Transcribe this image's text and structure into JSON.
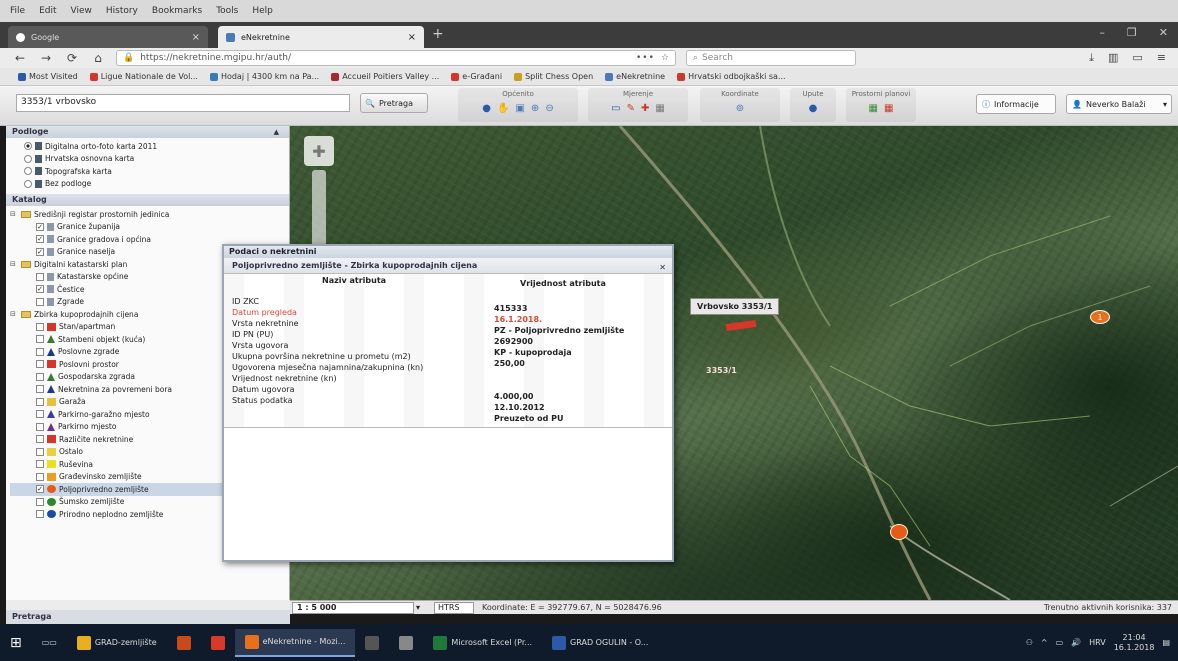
{
  "menu": [
    "File",
    "Edit",
    "View",
    "History",
    "Bookmarks",
    "Tools",
    "Help"
  ],
  "tabs": [
    {
      "label": "Google",
      "close": "×"
    },
    {
      "label": "eNekretnine",
      "close": "×"
    }
  ],
  "newtab": "+",
  "window_controls": [
    "–",
    "❐",
    "✕"
  ],
  "nav": {
    "back": "←",
    "forward": "→",
    "reload": "⟳",
    "home": "⌂",
    "url": "https://nekretnine.mgipu.hr/auth/",
    "url_dots": "•••",
    "search_placeholder": "Search"
  },
  "bookmarks": [
    "Most Visited",
    "Ligue Nationale de Vol...",
    "Hodaj | 4300 km na Pa...",
    "Accueil Poitiers Valley ...",
    "e-Građani",
    "Split Chess Open",
    "eNekretnine",
    "Hrvatski odbojkaški sa..."
  ],
  "app": {
    "search_value": "3353/1 vrbovsko",
    "search_button": "Pretraga",
    "groups": [
      "Općenito",
      "Mjerenje",
      "Koordinate",
      "Upute",
      "Prostorni planovi"
    ],
    "info_button": "Informacije",
    "user_button": "Neverko Balaži"
  },
  "left": {
    "podloge_title": "Podloge",
    "podloge": [
      {
        "label": "Digitalna orto-foto karta 2011",
        "selected": true
      },
      {
        "label": "Hrvatska osnovna karta",
        "selected": false
      },
      {
        "label": "Topografska karta",
        "selected": false
      },
      {
        "label": "Bez podloge",
        "selected": false
      }
    ],
    "katalog_title": "Katalog",
    "groups": [
      {
        "label": "Središnji registar prostornih jedinica",
        "items": [
          {
            "label": "Granice županija",
            "checked": true,
            "color": ""
          },
          {
            "label": "Granice gradova i općina",
            "checked": true,
            "color": ""
          },
          {
            "label": "Granice naselja",
            "checked": true,
            "color": ""
          }
        ]
      },
      {
        "label": "Digitalni katastarski plan",
        "items": [
          {
            "label": "Katastarske općine",
            "checked": false,
            "color": ""
          },
          {
            "label": "Čestice",
            "checked": true,
            "color": ""
          },
          {
            "label": "Zgrade",
            "checked": false,
            "color": ""
          }
        ]
      },
      {
        "label": "Zbirka kupoprodajnih cijena",
        "items": [
          {
            "label": "Stan/apartman",
            "checked": false,
            "color": "#d6362a"
          },
          {
            "label": "Stambeni objekt (kuća)",
            "checked": false,
            "color": "#3a7a2a"
          },
          {
            "label": "Poslovne zgrade",
            "checked": false,
            "color": "#1a3a8a"
          },
          {
            "label": "Poslovni prostor",
            "checked": false,
            "color": "#d6362a"
          },
          {
            "label": "Gospodarska zgrada",
            "checked": false,
            "color": "#3a7a2a"
          },
          {
            "label": "Nekretnina za povremeni bora",
            "checked": false,
            "color": "#1a3a8a"
          },
          {
            "label": "Garaža",
            "checked": false,
            "color": "#e8c040"
          },
          {
            "label": "Parkirno-garažno mjesto",
            "checked": false,
            "color": "#3a3aa8"
          },
          {
            "label": "Parkirno mjesto",
            "checked": false,
            "color": "#7a2a8a"
          },
          {
            "label": "Različite nekretnine",
            "checked": false,
            "color": "#d6362a"
          },
          {
            "label": "Ostalo",
            "checked": false,
            "color": "#e8d040"
          },
          {
            "label": "Ruševina",
            "checked": false,
            "color": "#e8e020"
          },
          {
            "label": "Građevinsko zemljište",
            "checked": false,
            "color": "#e8a020"
          },
          {
            "label": "Poljoprivredno zemljište",
            "checked": true,
            "color": "#e85a1a"
          },
          {
            "label": "Šumsko zemljište",
            "checked": false,
            "color": "#2a8a2a"
          },
          {
            "label": "Prirodno neplodno zemljište",
            "checked": false,
            "color": "#1a4aa8"
          }
        ]
      }
    ],
    "pretraga": "Pretraga"
  },
  "dialog": {
    "title": "Podaci o nekretnini",
    "subtitle": "Poljoprivredno zemljište - Zbirka kupoprodajnih cijena",
    "col_attr": "Naziv atributa",
    "col_val": "Vrijednost atributa",
    "rows": [
      {
        "attr": "ID ZKC",
        "val": "415333"
      },
      {
        "attr": "Datum pregleda",
        "val": "16.1.2018."
      },
      {
        "attr": "Vrsta nekretnine",
        "val": "PZ - Poljoprivredno zemljište"
      },
      {
        "attr": "ID PN (PU)",
        "val": "2692900"
      },
      {
        "attr": "Vrsta ugovora",
        "val": "KP - kupoprodaja"
      },
      {
        "attr": "Ukupna površina nekretnine u prometu (m2)",
        "val": "250,00"
      },
      {
        "attr": "Ugovorena mjesečna najamnina/zakupnina (kn)",
        "val": ""
      },
      {
        "attr": "Vrijednost nekretnine (kn)",
        "val": ""
      },
      {
        "attr": "Datum ugovora",
        "val": "4.000,00"
      },
      {
        "attr": "Status podatka",
        "val": "12.10.2012"
      },
      {
        "attr": "",
        "val": "Preuzeto od PU"
      }
    ]
  },
  "map": {
    "parcel_label": "Vrbovsko 3353/1",
    "marker1_text": "1",
    "parcel_text": "3353/1"
  },
  "status": {
    "scale": "1 : 5 000",
    "crs": "HTRS",
    "coords": "Koordinate: E = 392779.67, N = 5028476.96",
    "right": "Trenutno aktivnih korisnika: 337"
  },
  "taskbar": {
    "items": [
      {
        "label": "GRAD-zemljište",
        "active": false,
        "color": "#e8b020"
      },
      {
        "label": "",
        "active": false,
        "color": "#c84a1a"
      },
      {
        "label": "",
        "active": false,
        "color": "#d83a2a"
      },
      {
        "label": "eNekretnine - Mozi...",
        "active": true,
        "color": "#e8701a"
      },
      {
        "label": "",
        "active": false,
        "color": "#555"
      },
      {
        "label": "",
        "active": false,
        "color": "#888"
      },
      {
        "label": "Microsoft Excel (Pr...",
        "active": false,
        "color": "#1f7a3a"
      },
      {
        "label": "GRAD OGULIN - O...",
        "active": false,
        "color": "#2a5aa8"
      }
    ],
    "lang": "HRV",
    "time": "21:04",
    "date": "16.1.2018"
  }
}
